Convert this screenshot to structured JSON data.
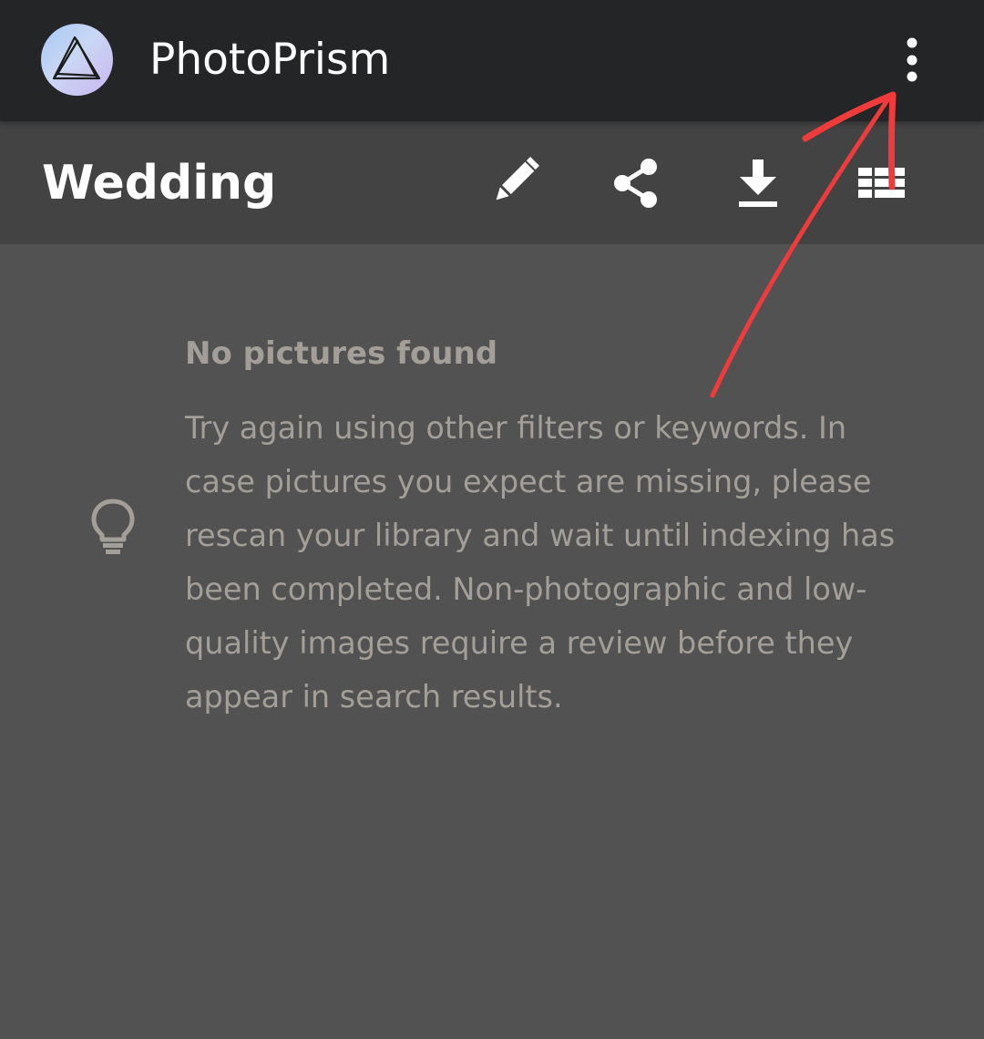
{
  "app_bar": {
    "title": "PhotoPrism",
    "logo_icon": "photoprism-logo-icon",
    "menu_icon": "more-vertical-icon"
  },
  "toolbar": {
    "title": "Wedding",
    "actions": [
      {
        "icon": "pencil-edit-icon"
      },
      {
        "icon": "share-icon"
      },
      {
        "icon": "download-icon"
      },
      {
        "icon": "view-list-icon"
      }
    ]
  },
  "empty_state": {
    "icon": "lightbulb-icon",
    "title": "No pictures found",
    "message": "Try again using other filters or keywords. In case pictures you expect are missing, please rescan your library and wait until indexing has been completed. Non-photographic and low-quality images require a review before they appear in search results."
  },
  "annotation": {
    "color": "#ef3b3b"
  },
  "colors": {
    "app_bar_bg": "#232526",
    "toolbar_bg": "#434343",
    "content_bg": "#525252",
    "muted_text": "#a39e98"
  }
}
